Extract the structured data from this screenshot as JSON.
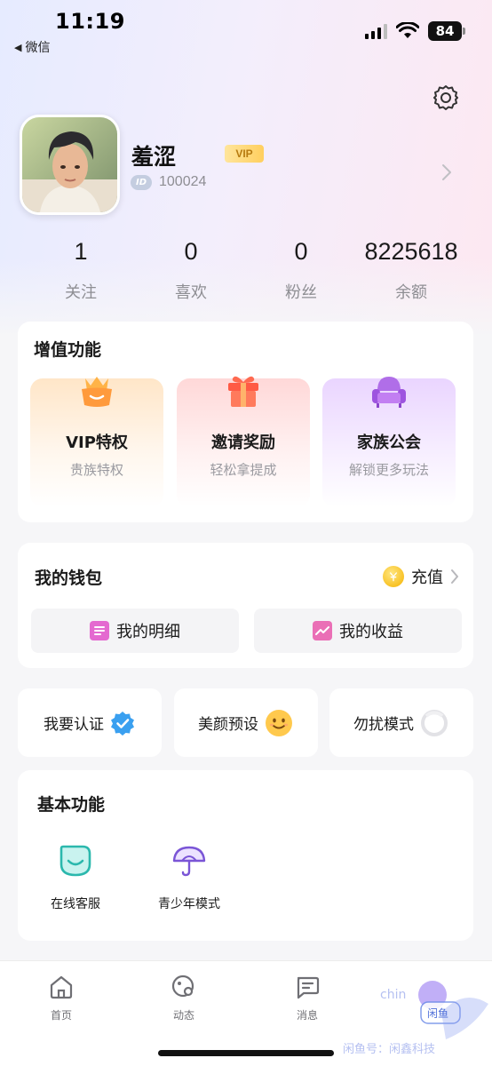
{
  "status_bar": {
    "time": "11:19",
    "back_label": "微信",
    "battery": "84"
  },
  "profile": {
    "nickname": "羞涩",
    "vip_badge": "VIP",
    "id_icon": "ID",
    "id_value": "100024"
  },
  "stats": [
    {
      "value": "1",
      "label": "关注"
    },
    {
      "value": "0",
      "label": "喜欢"
    },
    {
      "value": "0",
      "label": "粉丝"
    },
    {
      "value": "8225618",
      "label": "余额"
    }
  ],
  "value_added": {
    "title": "增值功能",
    "items": [
      {
        "title": "VIP特权",
        "subtitle": "贵族特权",
        "icon": "crown-basket-icon"
      },
      {
        "title": "邀请奖励",
        "subtitle": "轻松拿提成",
        "icon": "gift-icon"
      },
      {
        "title": "家族公会",
        "subtitle": "解锁更多玩法",
        "icon": "sofa-icon"
      }
    ]
  },
  "wallet": {
    "title": "我的钱包",
    "recharge": "充值",
    "detail": "我的明细",
    "income": "我的收益"
  },
  "quick": {
    "verify": "我要认证",
    "beauty": "美颜预设",
    "dnd": "勿扰模式",
    "dnd_enabled": false
  },
  "basic": {
    "title": "基本功能",
    "items": [
      {
        "label": "在线客服",
        "icon": "customer-service-icon"
      },
      {
        "label": "青少年模式",
        "icon": "umbrella-icon"
      }
    ]
  },
  "tabbar": {
    "items": [
      {
        "label": "首页",
        "icon": "home-icon"
      },
      {
        "label": "动态",
        "icon": "moments-icon"
      },
      {
        "label": "消息",
        "icon": "message-icon"
      }
    ]
  },
  "watermark": {
    "line1": "chin",
    "line2": "闲鱼号：闲鑫科技",
    "logo": "闲鱼"
  },
  "colors": {
    "accent_blue": "#3aa0f0",
    "vip_gold": "#ffcf5e",
    "purple": "#b47df0"
  }
}
